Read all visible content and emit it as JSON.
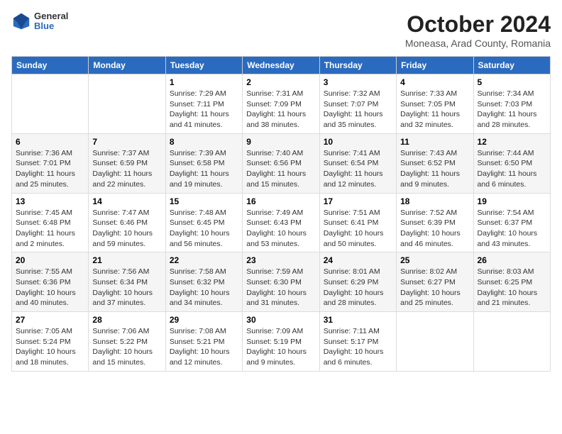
{
  "logo": {
    "general": "General",
    "blue": "Blue"
  },
  "title": "October 2024",
  "subtitle": "Moneasa, Arad County, Romania",
  "days_of_week": [
    "Sunday",
    "Monday",
    "Tuesday",
    "Wednesday",
    "Thursday",
    "Friday",
    "Saturday"
  ],
  "weeks": [
    [
      {
        "day": "",
        "info": ""
      },
      {
        "day": "",
        "info": ""
      },
      {
        "day": "1",
        "info": "Sunrise: 7:29 AM\nSunset: 7:11 PM\nDaylight: 11 hours and 41 minutes."
      },
      {
        "day": "2",
        "info": "Sunrise: 7:31 AM\nSunset: 7:09 PM\nDaylight: 11 hours and 38 minutes."
      },
      {
        "day": "3",
        "info": "Sunrise: 7:32 AM\nSunset: 7:07 PM\nDaylight: 11 hours and 35 minutes."
      },
      {
        "day": "4",
        "info": "Sunrise: 7:33 AM\nSunset: 7:05 PM\nDaylight: 11 hours and 32 minutes."
      },
      {
        "day": "5",
        "info": "Sunrise: 7:34 AM\nSunset: 7:03 PM\nDaylight: 11 hours and 28 minutes."
      }
    ],
    [
      {
        "day": "6",
        "info": "Sunrise: 7:36 AM\nSunset: 7:01 PM\nDaylight: 11 hours and 25 minutes."
      },
      {
        "day": "7",
        "info": "Sunrise: 7:37 AM\nSunset: 6:59 PM\nDaylight: 11 hours and 22 minutes."
      },
      {
        "day": "8",
        "info": "Sunrise: 7:39 AM\nSunset: 6:58 PM\nDaylight: 11 hours and 19 minutes."
      },
      {
        "day": "9",
        "info": "Sunrise: 7:40 AM\nSunset: 6:56 PM\nDaylight: 11 hours and 15 minutes."
      },
      {
        "day": "10",
        "info": "Sunrise: 7:41 AM\nSunset: 6:54 PM\nDaylight: 11 hours and 12 minutes."
      },
      {
        "day": "11",
        "info": "Sunrise: 7:43 AM\nSunset: 6:52 PM\nDaylight: 11 hours and 9 minutes."
      },
      {
        "day": "12",
        "info": "Sunrise: 7:44 AM\nSunset: 6:50 PM\nDaylight: 11 hours and 6 minutes."
      }
    ],
    [
      {
        "day": "13",
        "info": "Sunrise: 7:45 AM\nSunset: 6:48 PM\nDaylight: 11 hours and 2 minutes."
      },
      {
        "day": "14",
        "info": "Sunrise: 7:47 AM\nSunset: 6:46 PM\nDaylight: 10 hours and 59 minutes."
      },
      {
        "day": "15",
        "info": "Sunrise: 7:48 AM\nSunset: 6:45 PM\nDaylight: 10 hours and 56 minutes."
      },
      {
        "day": "16",
        "info": "Sunrise: 7:49 AM\nSunset: 6:43 PM\nDaylight: 10 hours and 53 minutes."
      },
      {
        "day": "17",
        "info": "Sunrise: 7:51 AM\nSunset: 6:41 PM\nDaylight: 10 hours and 50 minutes."
      },
      {
        "day": "18",
        "info": "Sunrise: 7:52 AM\nSunset: 6:39 PM\nDaylight: 10 hours and 46 minutes."
      },
      {
        "day": "19",
        "info": "Sunrise: 7:54 AM\nSunset: 6:37 PM\nDaylight: 10 hours and 43 minutes."
      }
    ],
    [
      {
        "day": "20",
        "info": "Sunrise: 7:55 AM\nSunset: 6:36 PM\nDaylight: 10 hours and 40 minutes."
      },
      {
        "day": "21",
        "info": "Sunrise: 7:56 AM\nSunset: 6:34 PM\nDaylight: 10 hours and 37 minutes."
      },
      {
        "day": "22",
        "info": "Sunrise: 7:58 AM\nSunset: 6:32 PM\nDaylight: 10 hours and 34 minutes."
      },
      {
        "day": "23",
        "info": "Sunrise: 7:59 AM\nSunset: 6:30 PM\nDaylight: 10 hours and 31 minutes."
      },
      {
        "day": "24",
        "info": "Sunrise: 8:01 AM\nSunset: 6:29 PM\nDaylight: 10 hours and 28 minutes."
      },
      {
        "day": "25",
        "info": "Sunrise: 8:02 AM\nSunset: 6:27 PM\nDaylight: 10 hours and 25 minutes."
      },
      {
        "day": "26",
        "info": "Sunrise: 8:03 AM\nSunset: 6:25 PM\nDaylight: 10 hours and 21 minutes."
      }
    ],
    [
      {
        "day": "27",
        "info": "Sunrise: 7:05 AM\nSunset: 5:24 PM\nDaylight: 10 hours and 18 minutes."
      },
      {
        "day": "28",
        "info": "Sunrise: 7:06 AM\nSunset: 5:22 PM\nDaylight: 10 hours and 15 minutes."
      },
      {
        "day": "29",
        "info": "Sunrise: 7:08 AM\nSunset: 5:21 PM\nDaylight: 10 hours and 12 minutes."
      },
      {
        "day": "30",
        "info": "Sunrise: 7:09 AM\nSunset: 5:19 PM\nDaylight: 10 hours and 9 minutes."
      },
      {
        "day": "31",
        "info": "Sunrise: 7:11 AM\nSunset: 5:17 PM\nDaylight: 10 hours and 6 minutes."
      },
      {
        "day": "",
        "info": ""
      },
      {
        "day": "",
        "info": ""
      }
    ]
  ]
}
